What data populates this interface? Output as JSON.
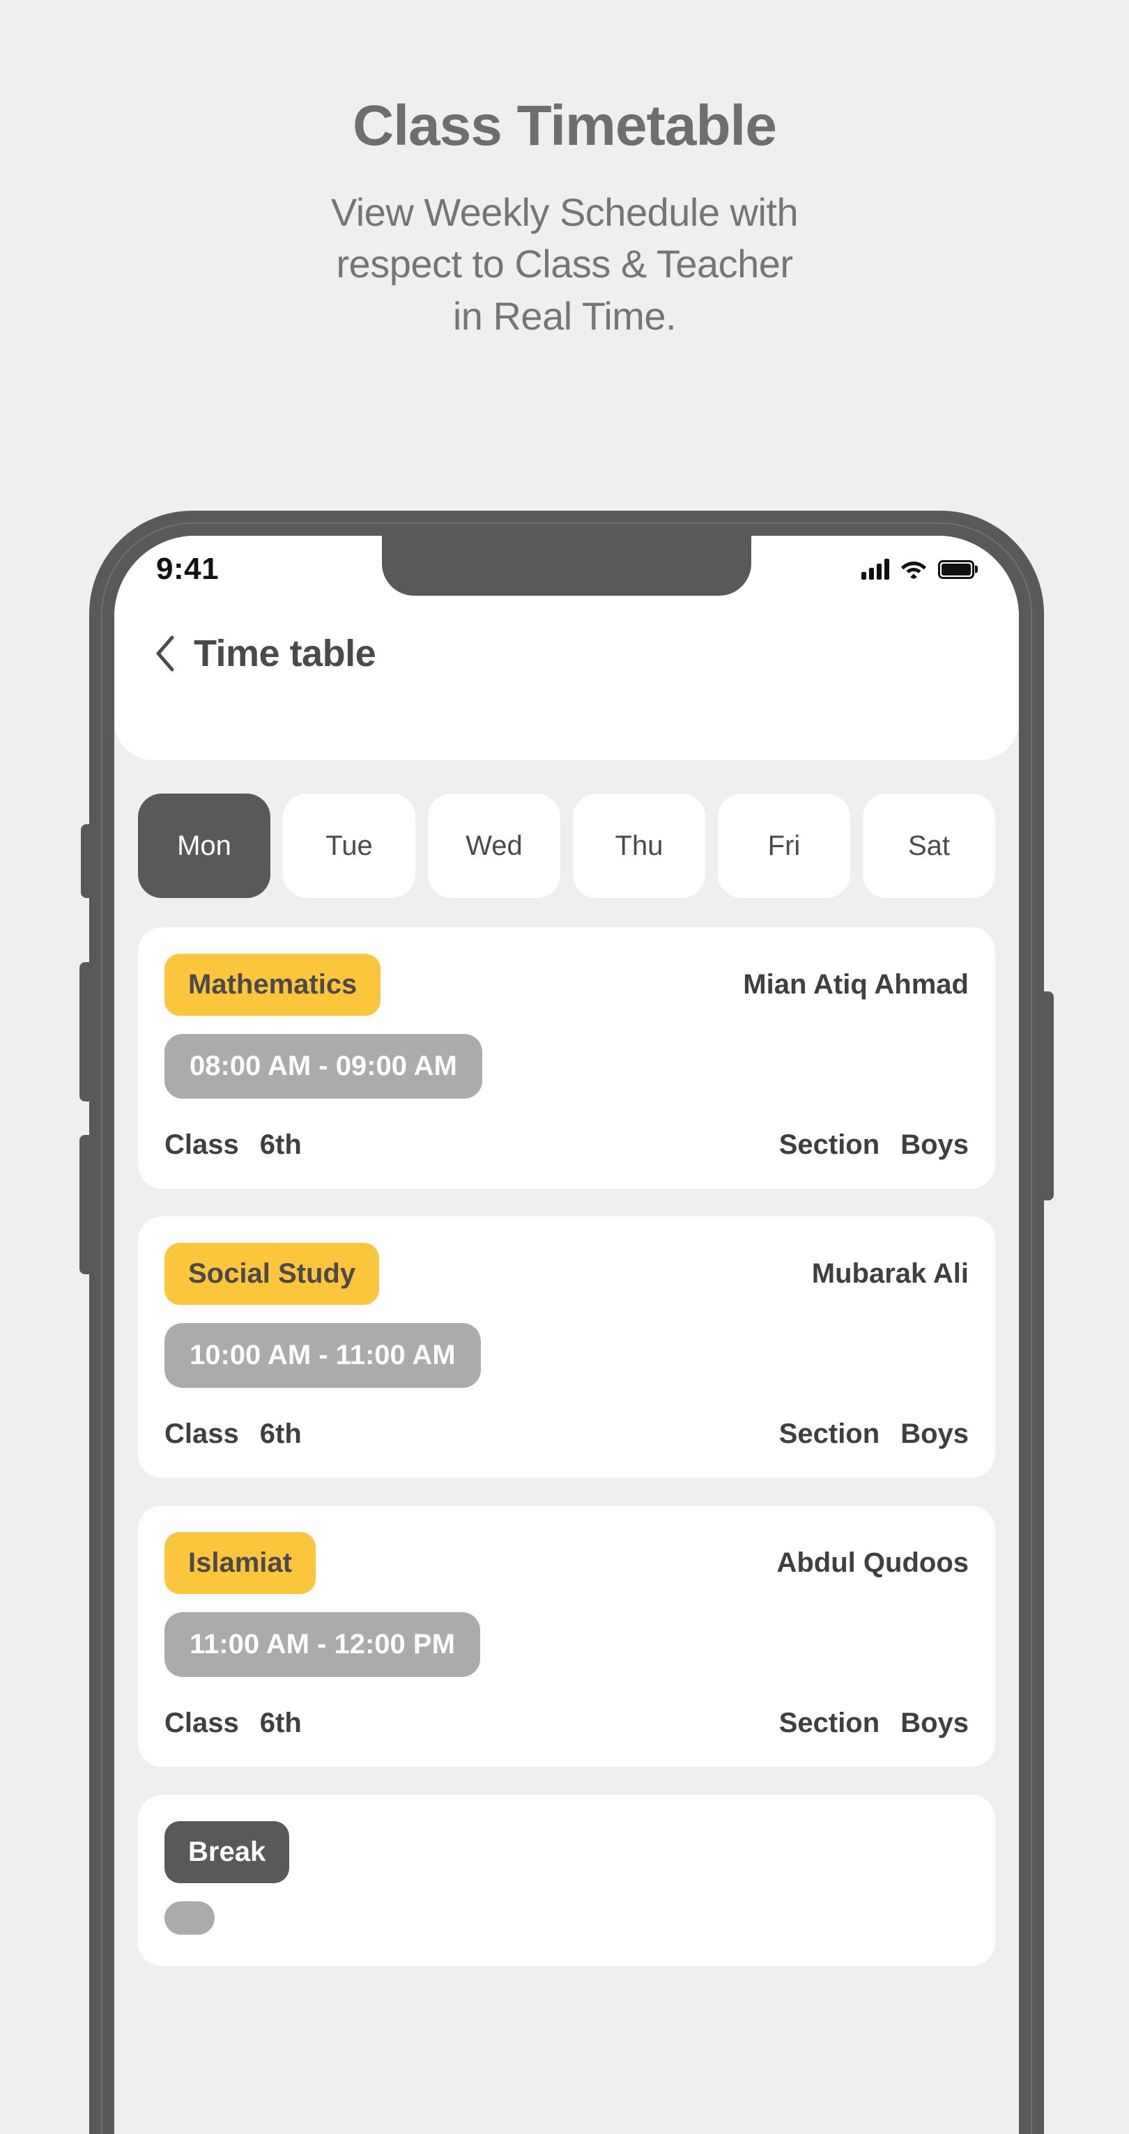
{
  "promo": {
    "title": "Class Timetable",
    "subtitle_lines": [
      "View Weekly Schedule with",
      "respect to Class & Teacher",
      "in Real Time."
    ]
  },
  "status_bar": {
    "time": "9:41",
    "signal_icon": "cellular-signal-icon",
    "wifi_icon": "wifi-icon",
    "battery_icon": "battery-full-icon"
  },
  "navbar": {
    "back_icon": "chevron-left-icon",
    "title": "Time table"
  },
  "day_tabs": {
    "active_index": 0,
    "items": [
      {
        "label": "Mon",
        "active": true
      },
      {
        "label": "Tue",
        "active": false
      },
      {
        "label": "Wed",
        "active": false
      },
      {
        "label": "Thu",
        "active": false
      },
      {
        "label": "Fri",
        "active": false
      },
      {
        "label": "Sat",
        "active": false
      }
    ]
  },
  "labels": {
    "class": "Class",
    "section": "Section"
  },
  "cards": [
    {
      "subject": "Mathematics",
      "teacher": "Mian Atiq Ahmad",
      "time": "08:00 AM - 09:00 AM",
      "class_label": "Class",
      "class_value": "6th",
      "section_label": "Section",
      "section_value": "Boys",
      "is_break": false
    },
    {
      "subject": "Social Study",
      "teacher": "Mubarak Ali",
      "time": "10:00 AM - 11:00 AM",
      "class_label": "Class",
      "class_value": "6th",
      "section_label": "Section",
      "section_value": "Boys",
      "is_break": false
    },
    {
      "subject": "Islamiat",
      "teacher": "Abdul Qudoos",
      "time": "11:00 AM - 12:00 PM",
      "class_label": "Class",
      "class_value": "6th",
      "section_label": "Section",
      "section_value": "Boys",
      "is_break": false
    },
    {
      "subject": "Break",
      "teacher": "",
      "time": "",
      "class_label": "",
      "class_value": "",
      "section_label": "",
      "section_value": "",
      "is_break": true
    }
  ],
  "colors": {
    "page_background": "#EFEFEF",
    "accent_yellow": "#FBC63C",
    "dark_gray": "#595959",
    "time_pill_gray": "#ABABAB",
    "text_dark": "#3F3F3F",
    "card_white": "#FFFFFF"
  }
}
